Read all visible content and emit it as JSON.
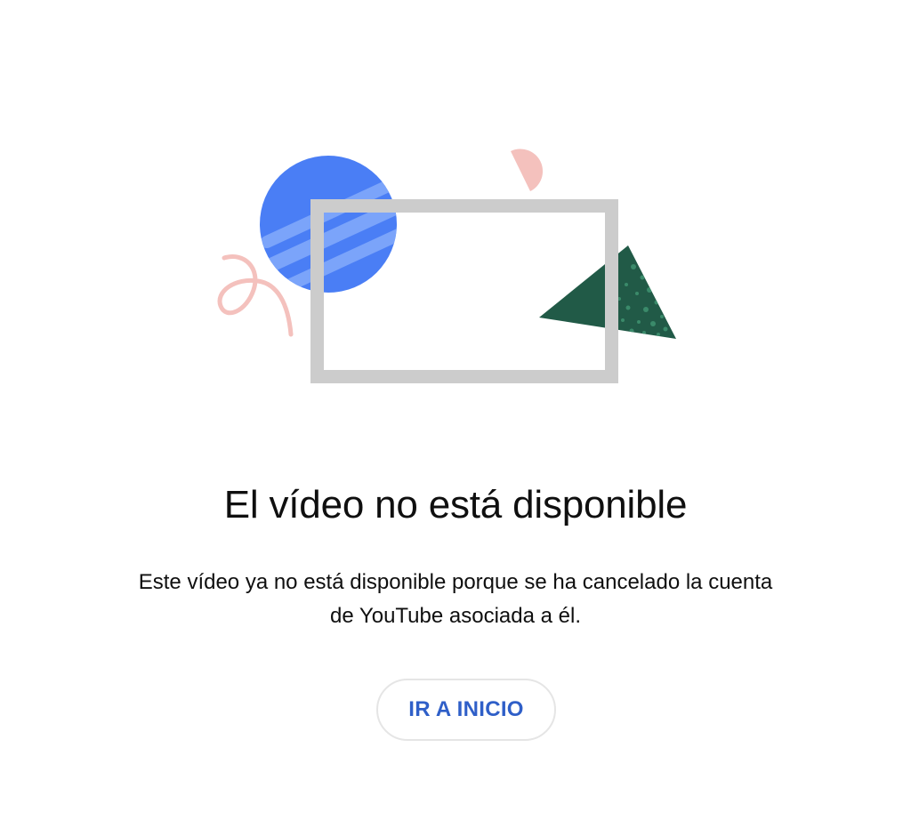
{
  "illustration": {
    "colors": {
      "circle": "#4a7ef5",
      "circle_stripes": "#7ba4fa",
      "frame": "#cccccc",
      "triangle": "#215a47",
      "triangle_speckle": "#3a8a6a",
      "accent_pink": "#f4c1bd"
    }
  },
  "content": {
    "title": "El vídeo no está disponible",
    "message": "Este vídeo ya no está disponible porque se ha cancelado la cuenta de YouTube asociada a él.",
    "home_button_label": "IR A INICIO"
  },
  "colors": {
    "text": "#0f0f0f",
    "button_text": "#2f5fc8",
    "button_border": "#e5e5e5"
  }
}
